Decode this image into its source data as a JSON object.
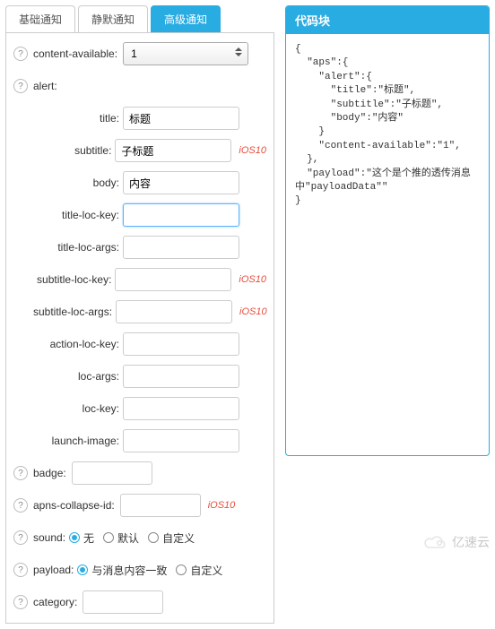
{
  "tabs": {
    "basic": "基础通知",
    "silent": "静默通知",
    "advanced": "高级通知",
    "activeIndex": 2
  },
  "form": {
    "helpGlyph": "?",
    "contentAvailable": {
      "label": "content-available:",
      "value": "1"
    },
    "alert": {
      "label": "alert:"
    },
    "fields": {
      "title": {
        "label": "title:",
        "value": "标题"
      },
      "subtitle": {
        "label": "subtitle:",
        "value": "子标题",
        "tag": "iOS10"
      },
      "body": {
        "label": "body:",
        "value": "内容"
      },
      "titleLocKey": {
        "label": "title-loc-key:",
        "value": ""
      },
      "titleLocArgs": {
        "label": "title-loc-args:",
        "value": ""
      },
      "subtitleLocKey": {
        "label": "subtitle-loc-key:",
        "value": "",
        "tag": "iOS10"
      },
      "subtitleLocArgs": {
        "label": "subtitle-loc-args:",
        "value": "",
        "tag": "iOS10"
      },
      "actionLocKey": {
        "label": "action-loc-key:",
        "value": ""
      },
      "locArgs": {
        "label": "loc-args:",
        "value": ""
      },
      "locKey": {
        "label": "loc-key:",
        "value": ""
      },
      "launchImage": {
        "label": "launch-image:",
        "value": ""
      }
    },
    "badge": {
      "label": "badge:",
      "value": ""
    },
    "apnsCollapseId": {
      "label": "apns-collapse-id:",
      "value": "",
      "tag": "iOS10"
    },
    "sound": {
      "label": "sound:",
      "options": {
        "none": "无",
        "default": "默认",
        "custom": "自定义"
      },
      "selected": "none"
    },
    "payload": {
      "label": "payload:",
      "options": {
        "same": "与消息内容一致",
        "custom": "自定义"
      },
      "selected": "same"
    },
    "category": {
      "label": "category:",
      "value": ""
    }
  },
  "codePanel": {
    "title": "代码块",
    "content": "{\n  \"aps\":{\n    \"alert\":{\n      \"title\":\"标题\",\n      \"subtitle\":\"子标题\",\n      \"body\":\"内容\"\n    }\n    \"content-available\":\"1\",\n  },\n  \"payload\":\"这个是个推的透传消息中\"payloadData\"\"\n}"
  },
  "watermark": {
    "text": "亿速云"
  }
}
